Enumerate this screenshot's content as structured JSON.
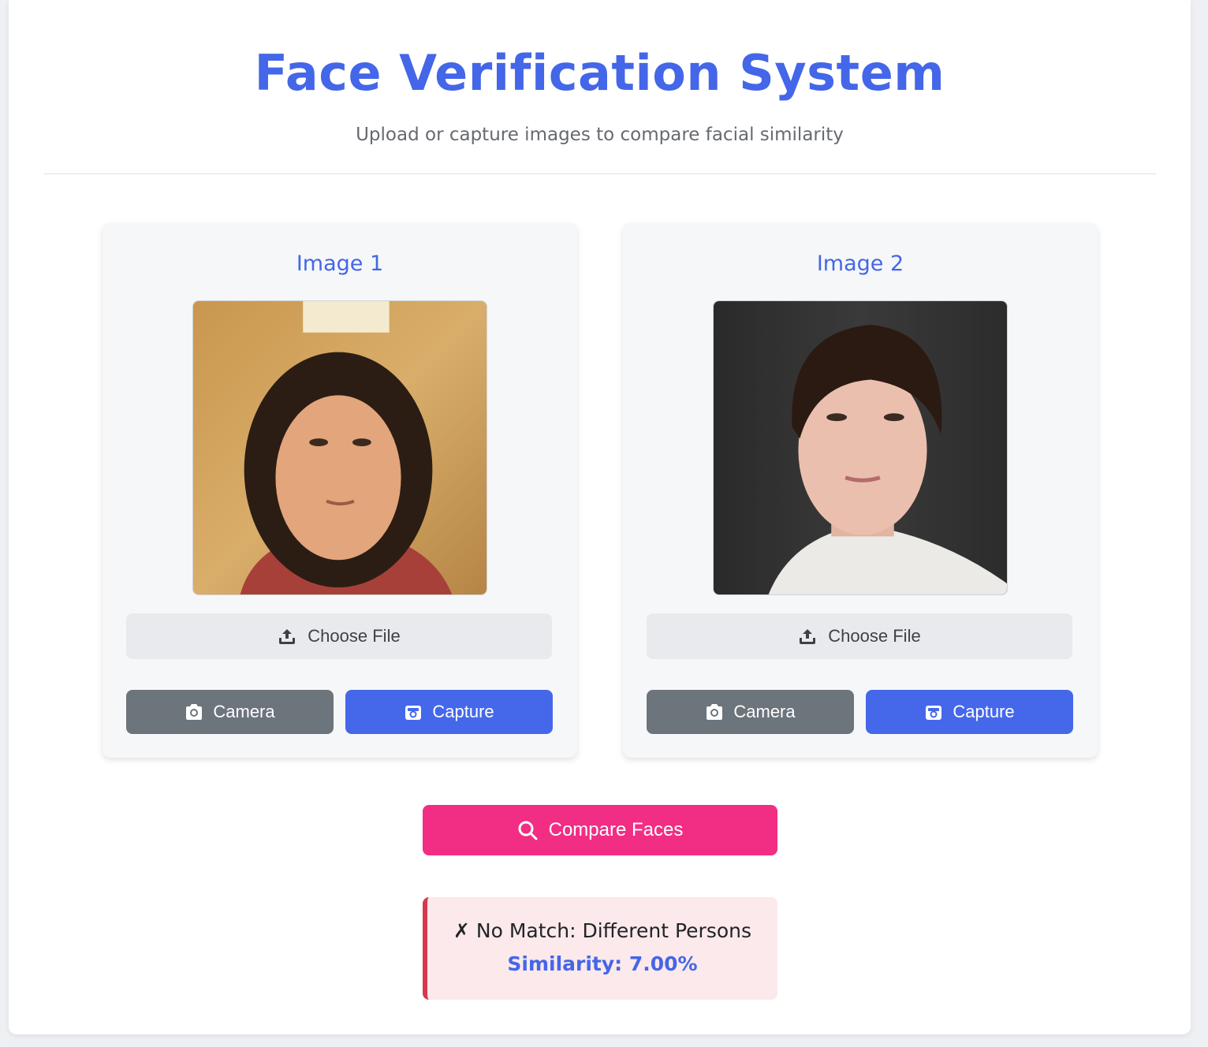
{
  "header": {
    "title": "Face Verification System",
    "subtitle": "Upload or capture images to compare facial similarity"
  },
  "panels": [
    {
      "title": "Image 1",
      "choose_file_label": "Choose File",
      "camera_label": "Camera",
      "capture_label": "Capture"
    },
    {
      "title": "Image 2",
      "choose_file_label": "Choose File",
      "camera_label": "Camera",
      "capture_label": "Capture"
    }
  ],
  "actions": {
    "compare_label": "Compare Faces"
  },
  "result": {
    "status_text": "✗ No Match: Different Persons",
    "similarity_text": "Similarity: 7.00%"
  },
  "colors": {
    "accent": "#4466e8",
    "compare": "#f22d84",
    "camera": "#6c747c",
    "no_match_border": "#d6394c"
  },
  "icons": [
    "upload-icon",
    "camera-icon",
    "capture-icon",
    "search-icon"
  ]
}
